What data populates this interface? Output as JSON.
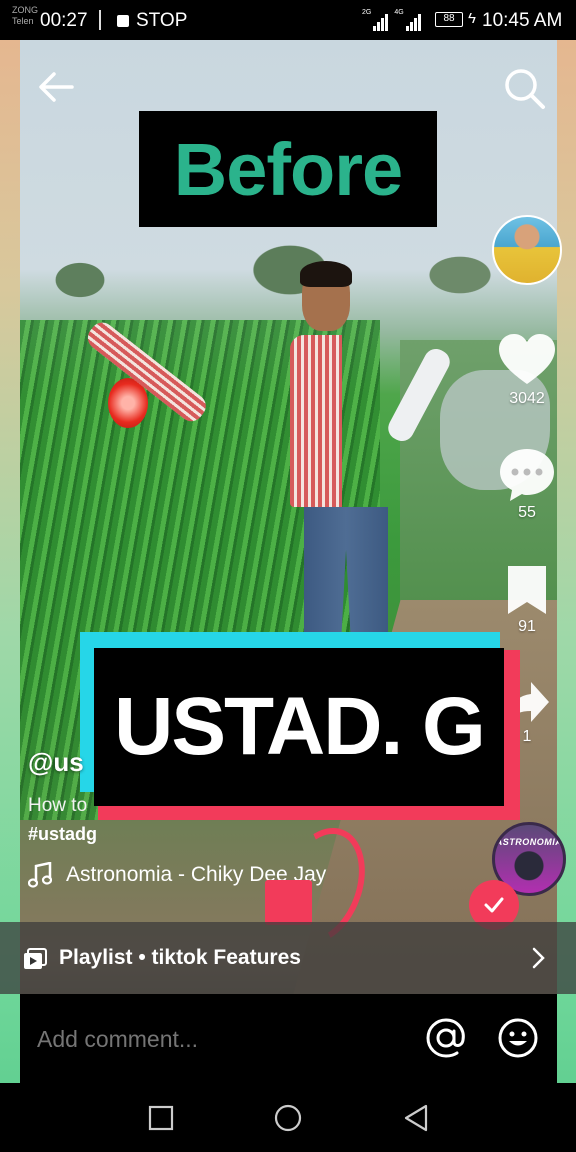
{
  "status_bar": {
    "carrier_1": "ZONG",
    "carrier_2": "Telen",
    "recording_time": "00:27",
    "stop_label": "STOP",
    "network_1": "2G",
    "network_2": "4G",
    "battery": "88",
    "time": "10:45 AM"
  },
  "video": {
    "before_label": "Before",
    "banner_text": "USTAD. G"
  },
  "right_rail": {
    "likes": "3042",
    "comments": "55",
    "saves": "91",
    "shares": "1"
  },
  "post": {
    "username": "@us",
    "description": "How to",
    "hashtag": "#ustadg",
    "music": "Astronomia - Chiky Dee Jay",
    "disc_label": "ASTRONOMIA"
  },
  "playlist": {
    "label": "Playlist • tiktok Features"
  },
  "comment": {
    "placeholder": "Add comment..."
  },
  "colors": {
    "accent_red": "#f23b5a",
    "accent_cyan": "#26d6e8",
    "before_green": "#2bb38c"
  }
}
